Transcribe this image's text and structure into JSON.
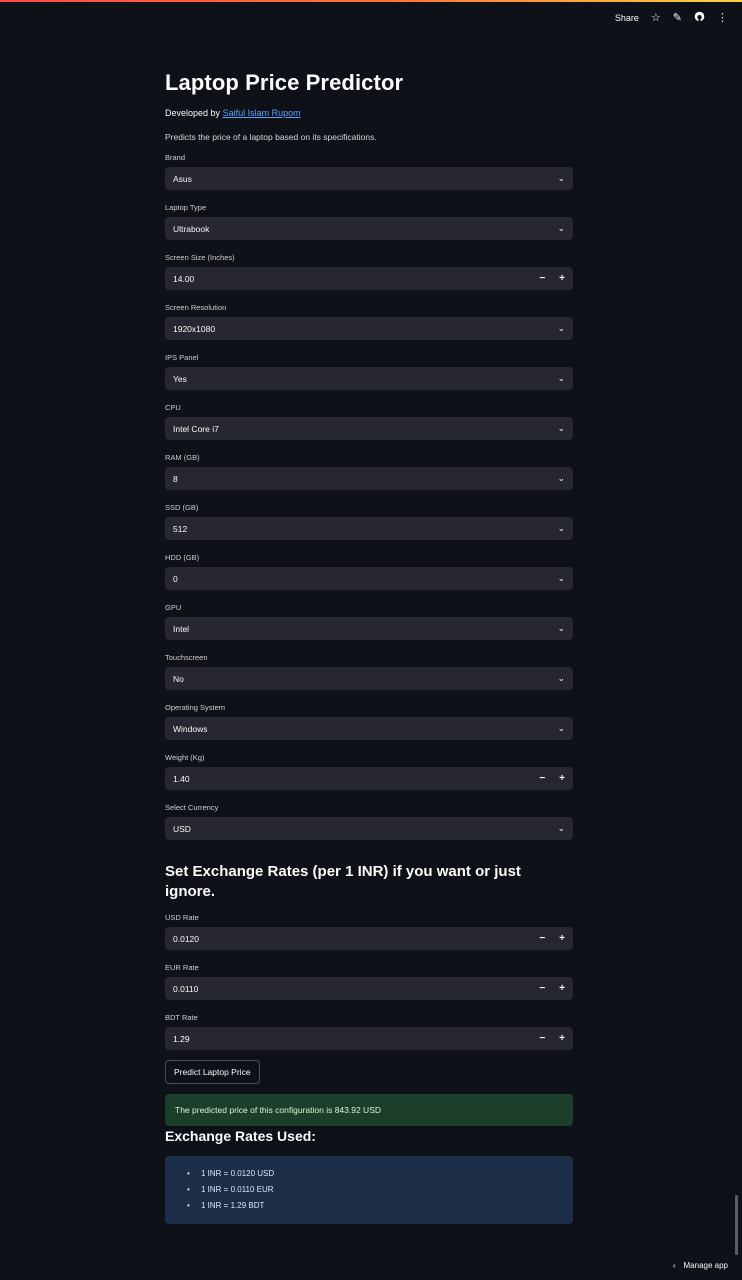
{
  "toolbar": {
    "share_label": "Share",
    "star_icon": "star-icon",
    "edit_icon": "pencil-icon",
    "github_icon": "github-icon",
    "menu_icon": "kebab-menu-icon"
  },
  "app": {
    "title": "Laptop Price Predictor",
    "developed_by_prefix": "Developed by",
    "developer_name": "Saiful Islam Rupom",
    "description": "Predicts the price of a laptop based on its specifications."
  },
  "fields": {
    "brand": {
      "label": "Brand",
      "value": "Asus"
    },
    "laptop_type": {
      "label": "Laptop Type",
      "value": "Ultrabook"
    },
    "screen_size": {
      "label": "Screen Size (Inches)",
      "value": "14.00"
    },
    "screen_resolution": {
      "label": "Screen Resolution",
      "value": "1920x1080"
    },
    "ips_panel": {
      "label": "IPS Panel",
      "value": "Yes"
    },
    "cpu": {
      "label": "CPU",
      "value": "Intel Core i7"
    },
    "ram": {
      "label": "RAM (GB)",
      "value": "8"
    },
    "ssd": {
      "label": "SSD (GB)",
      "value": "512"
    },
    "hdd": {
      "label": "HDD (GB)",
      "value": "0"
    },
    "gpu": {
      "label": "GPU",
      "value": "Intel"
    },
    "touchscreen": {
      "label": "Touchscreen",
      "value": "No"
    },
    "os": {
      "label": "Operating System",
      "value": "Windows"
    },
    "weight": {
      "label": "Weight (Kg)",
      "value": "1.40"
    },
    "currency": {
      "label": "Select Currency",
      "value": "USD"
    }
  },
  "stepper": {
    "minus": "−",
    "plus": "+"
  },
  "exchange": {
    "heading": "Set Exchange Rates (per 1 INR) if you want or just ignore.",
    "usd": {
      "label": "USD Rate",
      "value": "0.0120"
    },
    "eur": {
      "label": "EUR Rate",
      "value": "0.0110"
    },
    "bdt": {
      "label": "BDT Rate",
      "value": "1.29"
    }
  },
  "predict_button": "Predict Laptop Price",
  "result": "The predicted price of this configuration is 843.92 USD",
  "rates_used": {
    "heading": "Exchange Rates Used:",
    "items": [
      "1 INR = 0.0120 USD",
      "1 INR = 0.0110 EUR",
      "1 INR = 1.29 BDT"
    ]
  },
  "footer": {
    "manage_label": "Manage app"
  },
  "colors": {
    "background": "#0e1117",
    "input": "#262730",
    "link": "#5ea4ff",
    "success_bg": "#1c3f2b",
    "info_bg": "#1c2e47"
  }
}
